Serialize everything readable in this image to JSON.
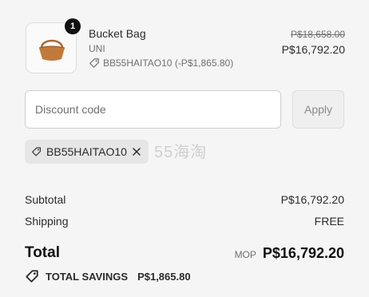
{
  "product": {
    "quantity": "1",
    "name": "Bucket Bag",
    "variant": "UNI",
    "discount_line": "BB55HAITAO10 (-P$1,865.80)",
    "original_price": "P$18,658.00",
    "price": "P$16,792.20",
    "image_icon": "bucket-bag-image"
  },
  "discount": {
    "placeholder": "Discount code",
    "value": "",
    "apply_label": "Apply",
    "applied_code": "BB55HAITAO10"
  },
  "watermark": "55海淘",
  "summary": {
    "subtotal_label": "Subtotal",
    "subtotal_value": "P$16,792.20",
    "shipping_label": "Shipping",
    "shipping_value": "FREE",
    "total_label": "Total",
    "total_currency": "MOP",
    "total_value": "P$16,792.20",
    "savings_label": "TOTAL SAVINGS",
    "savings_value": "P$1,865.80"
  },
  "colors": {
    "background": "#f5f5f5",
    "text": "#2b2b2b",
    "muted": "#707070",
    "chip": "#e6e6e6",
    "badge": "#111111"
  }
}
